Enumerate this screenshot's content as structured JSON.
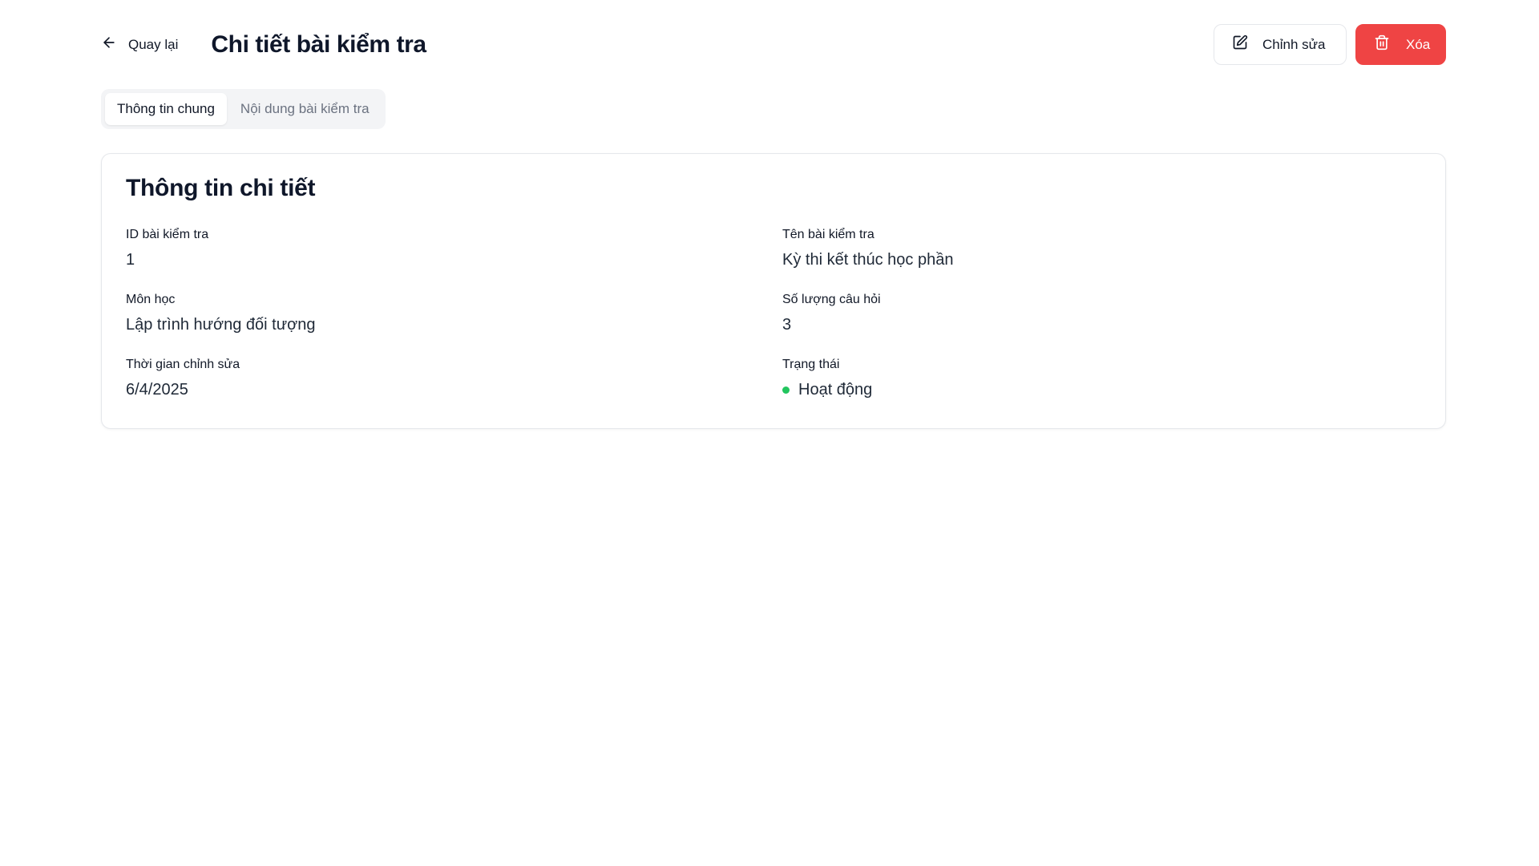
{
  "header": {
    "back_label": "Quay lại",
    "title": "Chi tiết bài kiểm tra",
    "edit_label": "Chỉnh sửa",
    "delete_label": "Xóa"
  },
  "tabs": [
    {
      "label": "Thông tin chung",
      "active": true
    },
    {
      "label": "Nội dung bài kiểm tra",
      "active": false
    }
  ],
  "card": {
    "title": "Thông tin chi tiết",
    "fields": [
      {
        "label": "ID bài kiểm tra",
        "value": "1"
      },
      {
        "label": "Tên bài kiểm tra",
        "value": "Kỳ thi kết thúc học phần"
      },
      {
        "label": "Môn học",
        "value": "Lập trình hướng đối tượng"
      },
      {
        "label": "Số lượng câu hỏi",
        "value": "3"
      },
      {
        "label": "Thời gian chỉnh sửa",
        "value": "6/4/2025"
      },
      {
        "label": "Trạng thái",
        "value": "Hoạt động"
      }
    ]
  },
  "icons": {
    "back": "arrow-left-icon",
    "edit": "pencil-square-icon",
    "delete": "trash-icon"
  },
  "colors": {
    "danger": "#ef4444",
    "status_active": "#22c55e",
    "border": "#e5e7eb",
    "tab_bg": "#f3f4f6"
  }
}
